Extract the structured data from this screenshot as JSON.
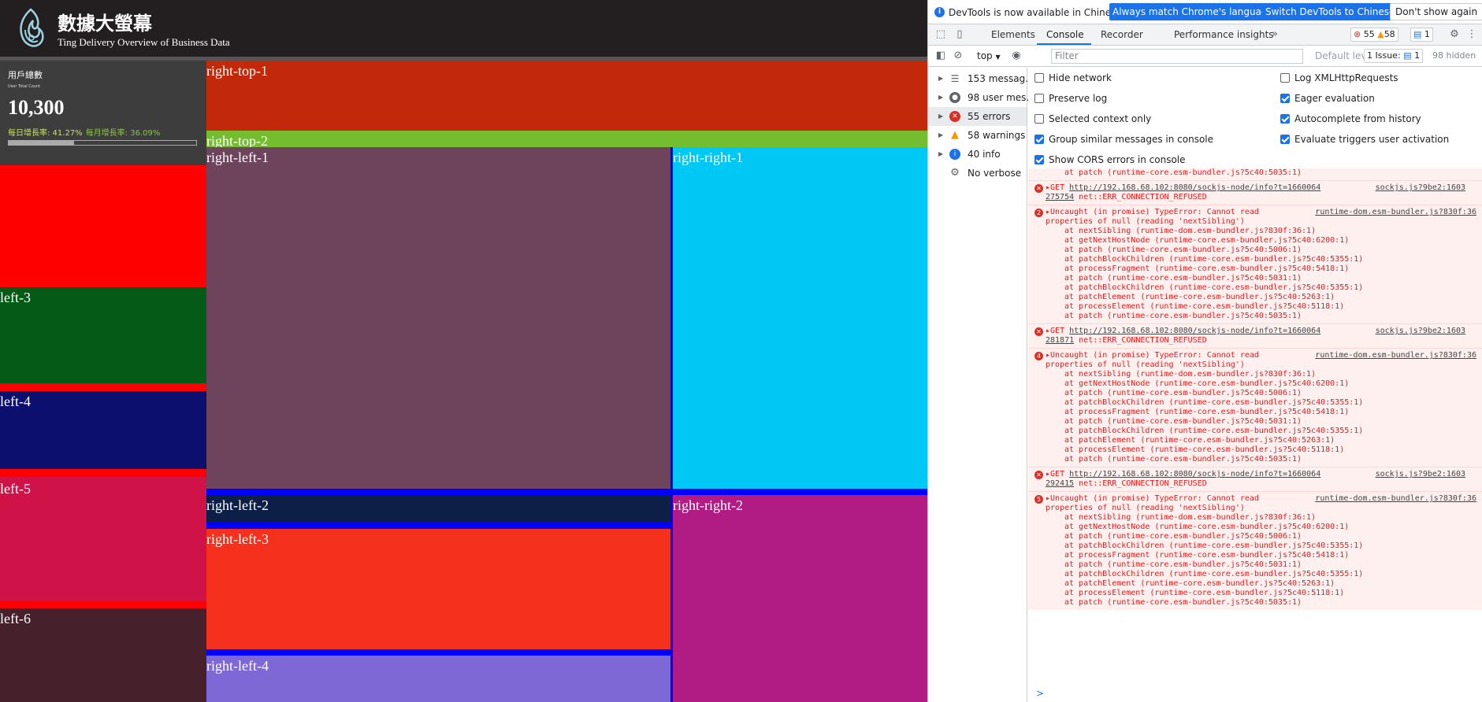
{
  "app": {
    "title": "數據大螢幕",
    "subtitle": "Ting Delivery Overview of Business Data",
    "stat": {
      "title": "用戶總數",
      "subtitle": "User Total Count",
      "value": "10,300",
      "daily_growth": "每日增長率: 41.27%",
      "monthly_growth": "每月增長率: 36.09%",
      "progress": 0.35
    },
    "panels": {
      "right_top_1": "right-top-1",
      "right_top_2": "right-top-2",
      "right_left_1": "right-left-1",
      "right_right_1": "right-right-1",
      "right_left_2": "right-left-2",
      "right_left_3": "right-left-3",
      "right_left_4": "right-left-4",
      "right_right_2": "right-right-2",
      "left_3": "left-3",
      "left_4": "left-4",
      "left_5": "left-5",
      "left_6": "left-6"
    }
  },
  "devtools": {
    "infobar": {
      "message": "DevTools is now available in Chinese!",
      "btn_match": "Always match Chrome's language",
      "btn_switch": "Switch DevTools to Chinese",
      "btn_dismiss": "Don't show again"
    },
    "tabs": [
      "Elements",
      "Console",
      "Recorder",
      "Performance insights"
    ],
    "counts": {
      "errors": "55",
      "warnings": "58",
      "messages": "1"
    },
    "filter": {
      "context": "top",
      "placeholder": "Filter",
      "levels": "Default levels",
      "issues": "1 Issue:",
      "issues_count": "1",
      "hidden": "98 hidden"
    },
    "sidebar": [
      {
        "label": "153 messag...",
        "icon": "list-icon"
      },
      {
        "label": "98 user mes...",
        "icon": "user-icon"
      },
      {
        "label": "55 errors",
        "icon": "error-icon"
      },
      {
        "label": "58 warnings",
        "icon": "warning-icon"
      },
      {
        "label": "40 info",
        "icon": "info-icon"
      },
      {
        "label": "No verbose",
        "icon": "gear-icon"
      }
    ],
    "settings": {
      "hide_network": "Hide network",
      "preserve_log": "Preserve log",
      "selected_context": "Selected context only",
      "group_similar": "Group similar messages in console",
      "show_cors": "Show CORS errors in console",
      "log_xhr": "Log XMLHttpRequests",
      "eager_eval": "Eager evaluation",
      "autocomplete": "Autocomplete from history",
      "eval_triggers": "Evaluate triggers user activation"
    },
    "console": {
      "top_line": "at patch (runtime-core.esm-bundler.js?5c40:5035:1)",
      "get1_url": "http://192.168.68.102:8080/sockjs-node/info?t=1660064",
      "get1_url2": "275754",
      "get2_url2": "281871",
      "get3_url2": "292415",
      "get_err": "net::ERR_CONNECTION_REFUSED",
      "get_src": "sockjs.js?9be2:1603",
      "err_msg1": "Uncaught (in promise) TypeError: Cannot read",
      "err_msg2": "properties of null (reading 'nextSibling')",
      "err_src": "runtime-dom.esm-bundler.js?830f:36",
      "count_a": "2",
      "count_b": "4",
      "count_c": "5",
      "stack": [
        "at nextSibling (runtime-dom.esm-bundler.js?830f:36:1)",
        "at getNextHostNode (runtime-core.esm-bundler.js?5c40:6200:1)",
        "at patch (runtime-core.esm-bundler.js?5c40:5006:1)",
        "at patchBlockChildren (runtime-core.esm-bundler.js?5c40:5355:1)",
        "at processFragment (runtime-core.esm-bundler.js?5c40:5418:1)",
        "at patch (runtime-core.esm-bundler.js?5c40:5031:1)",
        "at patchBlockChildren (runtime-core.esm-bundler.js?5c40:5355:1)",
        "at patchElement (runtime-core.esm-bundler.js?5c40:5263:1)",
        "at processElement (runtime-core.esm-bundler.js?5c40:5118:1)",
        "at patch (runtime-core.esm-bundler.js?5c40:5035:1)"
      ]
    },
    "prompt": ">"
  },
  "colors": {
    "right_top_1": "#c1290a",
    "right_top_2": "#74bd2f",
    "right_left_1": "#6d445c",
    "right_right_1": "#00c8f5",
    "right_left_2": "#0d1f46",
    "right_left_3": "#f5301c",
    "right_left_4": "#7e68d6",
    "right_right_2": "#b11b84",
    "left_red": "#ff0000",
    "left_3": "#045a16",
    "left_4": "#0c0f6d",
    "left_5": "#cf1247",
    "left_6": "#46202a",
    "separator": "#0000ff"
  }
}
